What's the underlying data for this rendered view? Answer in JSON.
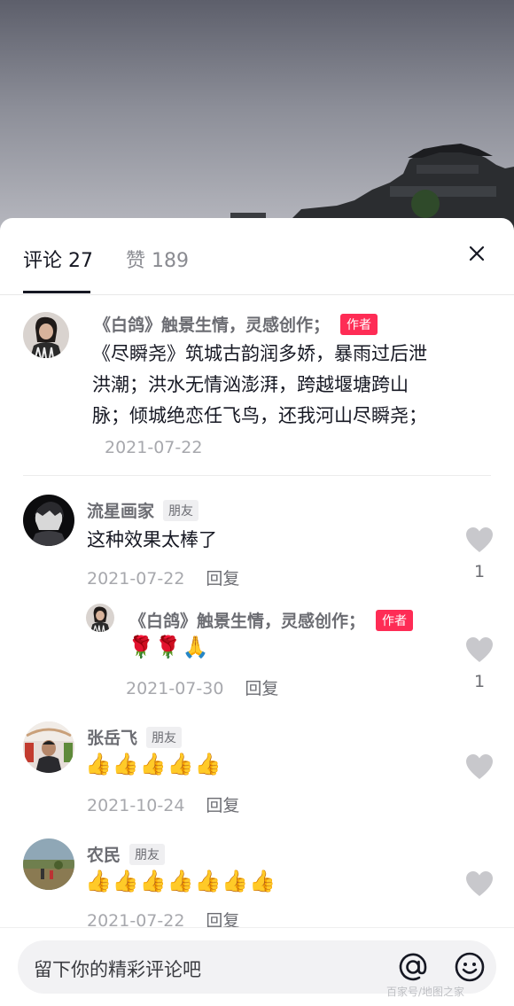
{
  "tabs": {
    "comments": "评论 27",
    "likes": "赞 189"
  },
  "author_post": {
    "name": "《白鸽》触景生情，灵感创作；",
    "badge": "作者",
    "text": "《尽瞬尧》筑城古韵润多娇，暴雨过后泄洪潮；洪水无情汹澎湃，跨越堰塘跨山脉；倾城绝恋任飞鸟，还我河山尽瞬尧；",
    "date": "2021-07-22"
  },
  "comments": [
    {
      "name": "流星画家",
      "badge": "朋友",
      "text": "这种效果太棒了",
      "date": "2021-07-22",
      "reply": "回复",
      "likes": "1",
      "replies": [
        {
          "name": "《白鸽》触景生情，灵感创作；",
          "badge": "作者",
          "text": "🌹🌹🙏",
          "date": "2021-07-30",
          "reply": "回复",
          "likes": "1"
        }
      ]
    },
    {
      "name": "张岳飞",
      "badge": "朋友",
      "text": "👍👍👍👍👍",
      "date": "2021-10-24",
      "reply": "回复"
    },
    {
      "name": "农民",
      "badge": "朋友",
      "text": "👍👍👍👍👍👍👍",
      "date": "2021-07-22",
      "reply": "回复"
    }
  ],
  "input": {
    "placeholder": "留下你的精彩评论吧"
  },
  "watermark": "百家号/地图之家",
  "colors": {
    "accent": "#fe2c55",
    "text": "#161823",
    "muted": "#a7a8ad"
  },
  "icons": [
    "close-icon",
    "heart-icon",
    "at-icon",
    "smile-icon"
  ]
}
